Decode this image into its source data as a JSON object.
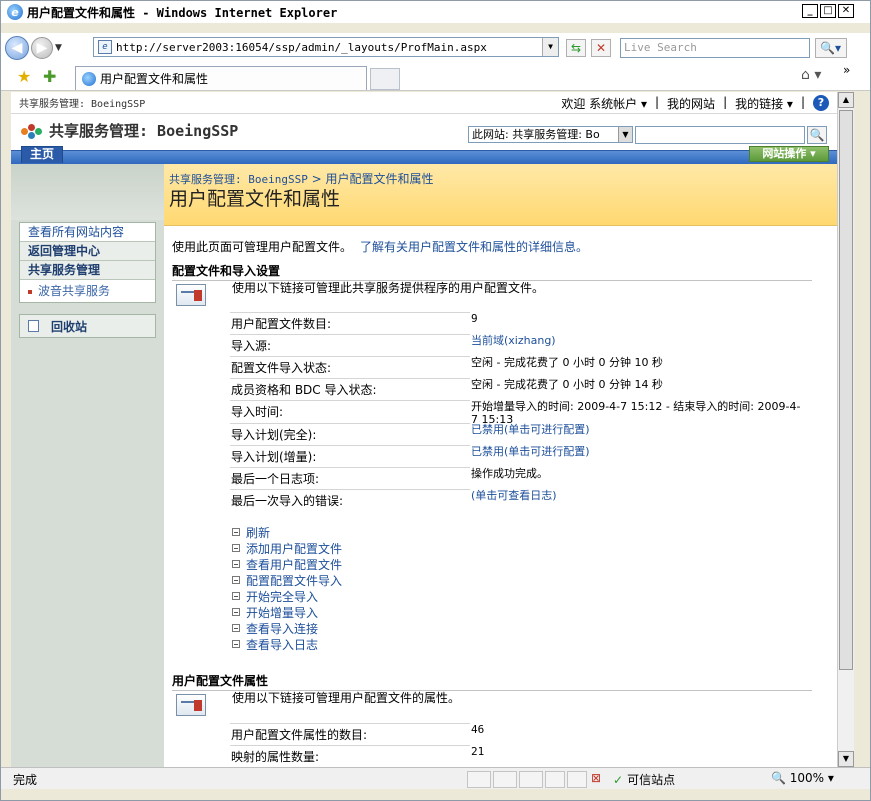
{
  "browser": {
    "window_title": "用户配置文件和属性 - Windows Internet Explorer",
    "address": "http://server2003:16054/ssp/admin/_layouts/ProfMain.aspx",
    "search_placeholder": "Live Search",
    "tab_title": "用户配置文件和属性",
    "status_text": "完成",
    "zone_text": "可信站点",
    "zoom_text": "100%"
  },
  "sharepoint": {
    "top_breadcrumb": "共享服务管理: BoeingSSP",
    "welcome": "欢迎 系统帐户 ▾",
    "my_site": "我的网站",
    "my_links": "我的链接 ▾",
    "site_title": "共享服务管理: BoeingSSP",
    "search_scope": "此网站: 共享服务管理: Bo",
    "home_tab": "主页",
    "site_actions": "网站操作 ▾",
    "crumb_root": "共享服务管理: BoeingSSP",
    "crumb_sep": " > ",
    "crumb_current": "用户配置文件和属性",
    "page_title": "用户配置文件和属性"
  },
  "left_nav": {
    "items": [
      {
        "label": "查看所有网站内容"
      },
      {
        "label": "返回管理中心"
      },
      {
        "label": "共享服务管理"
      },
      {
        "label": "波音共享服务"
      }
    ],
    "recycle_bin": "回收站"
  },
  "content": {
    "intro": "使用此页面可管理用户配置文件。",
    "intro_link": "了解有关用户配置文件和属性的详细信息。",
    "section1_title": "配置文件和导入设置",
    "section1_desc": "使用以下链接可管理此共享服务提供程序的用户配置文件。",
    "rows": [
      {
        "key": "用户配置文件数目:",
        "value": "9"
      },
      {
        "key": "导入源:",
        "value": "当前域(xizhang)"
      },
      {
        "key": "配置文件导入状态:",
        "value": "空闲 - 完成花费了 0 小时 0 分钟 10 秒"
      },
      {
        "key": "成员资格和 BDC 导入状态:",
        "value": "空闲 - 完成花费了 0 小时 0 分钟 14 秒"
      },
      {
        "key": "导入时间:",
        "value": "开始增量导入的时间: 2009-4-7 15:12 - 结束导入的时间: 2009-4-7 15:13"
      },
      {
        "key": "导入计划(完全):",
        "value": "已禁用(单击可进行配置)"
      },
      {
        "key": "导入计划(增量):",
        "value": "已禁用(单击可进行配置)"
      },
      {
        "key": "最后一个日志项:",
        "value": "操作成功完成。"
      },
      {
        "key": "最后一次导入的错误:",
        "value": "(单击可查看日志)"
      }
    ],
    "operations": [
      "刷新",
      "添加用户配置文件",
      "查看用户配置文件",
      "配置配置文件导入",
      "开始完全导入",
      "开始增量导入",
      "查看导入连接",
      "查看导入日志"
    ],
    "section2_title": "用户配置文件属性",
    "section2_desc": "使用以下链接可管理用户配置文件的属性。",
    "rows2": [
      {
        "key": "用户配置文件属性的数目:",
        "value": "46"
      },
      {
        "key": "映射的属性数量:",
        "value": "21"
      }
    ]
  },
  "colors": {
    "accent": "#1d4f9a",
    "title_band": "#ffd870",
    "nav_bar": "#2f68be"
  }
}
